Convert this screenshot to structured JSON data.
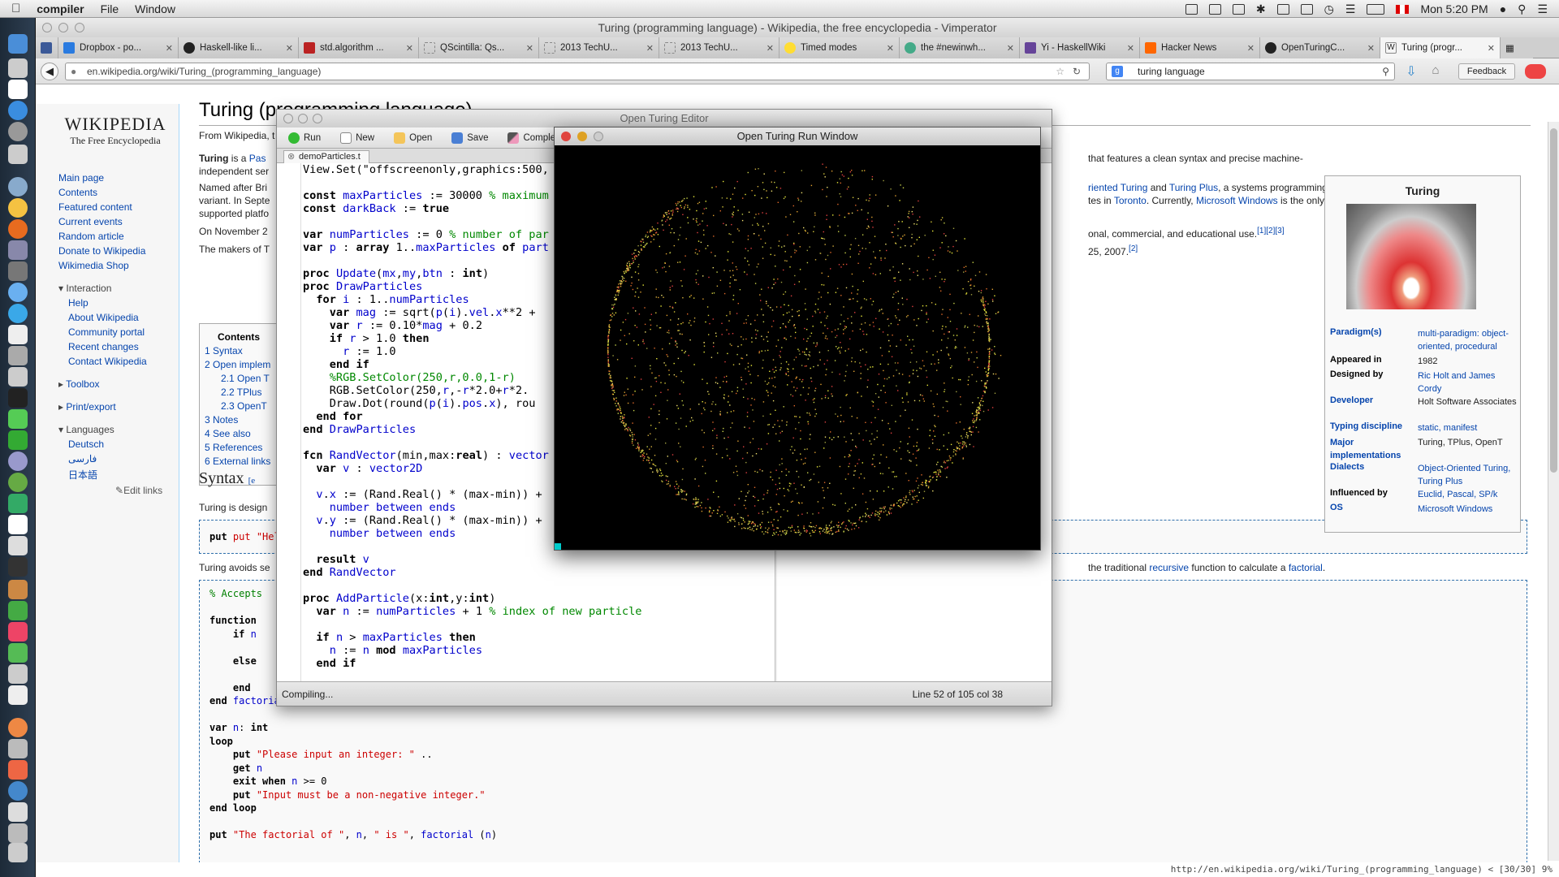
{
  "menubar": {
    "app": "compiler",
    "items": [
      "File",
      "Window"
    ],
    "clock": "Mon 5:20 PM"
  },
  "browser": {
    "title": "Turing (programming language) - Wikipedia, the free encyclopedia - Vimperator",
    "tabs": [
      "Dropbox - po...",
      "Haskell-like li...",
      "std.algorithm ...",
      "QScintilla: Qs...",
      "2013 TechU...",
      "2013 TechU...",
      "Timed modes",
      "the #newinwh...",
      "Yi - HaskellWiki",
      "Hacker News",
      "OpenTuringC...",
      "Turing (progr..."
    ],
    "url": "en.wikipedia.org/wiki/Turing_(programming_language)",
    "search": "turing language",
    "feedback": "Feedback",
    "status": "http://en.wikipedia.org/wiki/Turing_(programming_language) < [30/30] 9%"
  },
  "wiki": {
    "logo_title": "WIKIPEDIA",
    "logo_sub": "The Free Encyclopedia",
    "nav": [
      "Main page",
      "Contents",
      "Featured content",
      "Current events",
      "Random article",
      "Donate to Wikipedia",
      "Wikimedia Shop"
    ],
    "interaction_head": "Interaction",
    "interaction": [
      "Help",
      "About Wikipedia",
      "Community portal",
      "Recent changes",
      "Contact Wikipedia"
    ],
    "toolbox": "Toolbox",
    "printexport": "Print/export",
    "languages_head": "Languages",
    "languages": [
      "Deutsch",
      "فارسی",
      "日本語"
    ],
    "edit_links": "Edit links",
    "heading": "Turing (programming language)",
    "from": "From Wikipedia, t",
    "p1a": "Turing",
    "p1b": " is a ",
    "p1c": "Pas",
    "p1d": "independent ser",
    "p1e": "that features a clean syntax and precise machine-",
    "p2a": "Named after Bri",
    "p2b": "variant. In Septe",
    "p2c": "supported platfo",
    "p2d": "riented Turing",
    "p2e": " and ",
    "p2f": "Turing Plus",
    "p2g": ", a systems programming",
    "p2h": "tes in ",
    "p2i": "Toronto",
    "p2j": ". Currently, ",
    "p2k": "Microsoft Windows",
    "p2l": " is the only",
    "p3a": "On November 2",
    "p3b": "onal, commercial, and educational use.",
    "p3c": "[1][2][3]",
    "p4a": "The makers of T",
    "p4b": "25, 2007.",
    "p4c": "[2]",
    "toc_title": "Contents",
    "toc": [
      "1 Syntax",
      "2 Open implem",
      "2.1 Open T",
      "2.2 TPlus",
      "2.3 OpenT",
      "3 Notes",
      "4 See also",
      "5 References",
      "6 External links"
    ],
    "syntax_h": "Syntax",
    "syntax_edit": "[e",
    "syntax_p": "Turing is design",
    "hello": "put \"Hello",
    "avoids": "Turing avoids se",
    "avoids_r1": "the traditional ",
    "avoids_r2": "recursive",
    "avoids_r3": " function to calculate a ",
    "avoids_r4": "factorial",
    "infobox": {
      "title": "Turing",
      "rows": [
        {
          "k": "Paradigm(s)",
          "v": "multi-paradigm: object-oriented, procedural"
        },
        {
          "k": "Appeared in",
          "v": "1982"
        },
        {
          "k": "Designed by",
          "v": "Ric Holt and James Cordy"
        },
        {
          "k": "Developer",
          "v": "Holt Software Associates"
        },
        {
          "k": "Typing discipline",
          "v": "static, manifest"
        },
        {
          "k": "Major implementations",
          "v": "Turing, TPlus, OpenT"
        },
        {
          "k": "Dialects",
          "v": "Object-Oriented Turing, Turing Plus"
        },
        {
          "k": "Influenced by",
          "v": "Euclid, Pascal, SP/k"
        },
        {
          "k": "OS",
          "v": "Microsoft Windows"
        }
      ]
    }
  },
  "editor": {
    "title": "Open Turing Editor",
    "toolbar": [
      "Run",
      "New",
      "Open",
      "Save",
      "Complete"
    ],
    "tab": "demoParticles.t",
    "status_left": "Compiling...",
    "status_right": "Line 52 of 105 col 38"
  },
  "run": {
    "title": "Open Turing Run Window"
  },
  "colors": {
    "link": "#0645ad",
    "accent": "#2f6fab"
  }
}
